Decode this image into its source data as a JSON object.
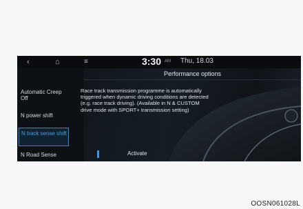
{
  "statusbar": {
    "back_icon": "back-arrow-icon",
    "home_icon": "home-icon",
    "menu_icon": "menu-icon",
    "time": "3:30",
    "ampm": "AM",
    "date": "Thu, 18.03"
  },
  "page": {
    "title": "Performance options"
  },
  "sidebar": {
    "items": [
      {
        "label": "Automatic Creep Off",
        "selected": false
      },
      {
        "label": "N power shift",
        "selected": false
      },
      {
        "label": "N track sense shift",
        "selected": true
      },
      {
        "label": "N Road Sense",
        "selected": false
      }
    ]
  },
  "description": "Race track transmission programme is automatically triggered when dynamic driving conditions are detected (e.g. race track driving). (Available in N & CUSTOM drive mode with SPORT+ transmission setting)",
  "action": {
    "label": "Activate"
  },
  "caption": "OOSN061028L",
  "colors": {
    "accent": "#1f8fd6",
    "screen_bg": "#0c0f13",
    "page_bg": "#f7f7f7"
  }
}
